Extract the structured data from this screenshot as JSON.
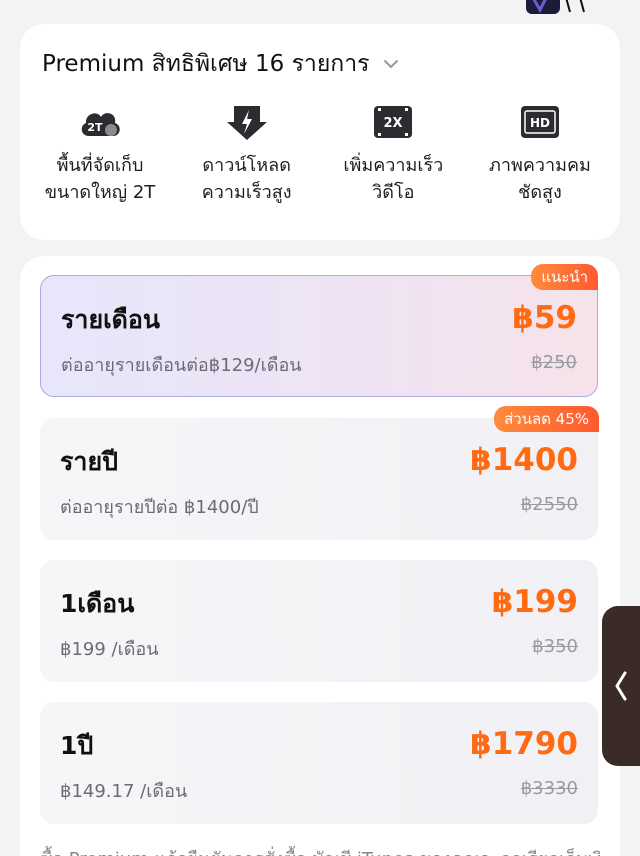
{
  "benefits": {
    "header_title": "Premium สิทธิพิเศษ 16 รายการ",
    "items": [
      {
        "label": "พื้นที่จัดเก็บ\nขนาดใหญ่ 2T",
        "icon": "cloud-storage-icon",
        "badge": "2T"
      },
      {
        "label": "ดาวน์โหลด\nความเร็วสูง",
        "icon": "fast-download-icon"
      },
      {
        "label": "เพิ่มความเร็ว\nวิดีโอ",
        "icon": "speed-2x-icon",
        "badge": "2X"
      },
      {
        "label": "ภาพความคม\nชัดสูง",
        "icon": "hd-icon",
        "badge": "HD"
      }
    ]
  },
  "plans": [
    {
      "name": "รายเดือน",
      "desc": "ต่ออายุรายเดือนต่อ฿129/เดือน",
      "price": "฿59",
      "old_price": "฿250",
      "tag": "แนะนำ",
      "selected": true
    },
    {
      "name": "รายปี",
      "desc": "ต่ออายุรายปีต่อ ฿1400/ปี",
      "price": "฿1400",
      "old_price": "฿2550",
      "tag": "ส่วนลด 45%",
      "selected": false
    },
    {
      "name": "1เดือน",
      "desc": "฿199 /เดือน",
      "price": "฿199",
      "old_price": "฿350",
      "tag": "",
      "selected": false
    },
    {
      "name": "1ปี",
      "desc": "฿149.17 /เดือน",
      "price": "฿1790",
      "old_price": "฿3330",
      "tag": "",
      "selected": false
    }
  ],
  "bottom_note": "ซื้อ Premium แล้วยืนยันการสั่งซื้อ บัญชี iTunes ของคุณจะถูกเรียกเก็บเงิน",
  "colors": {
    "accent": "#ff6a13",
    "selected_border": "#a9a6ea",
    "tag": "#ff5a2e"
  }
}
